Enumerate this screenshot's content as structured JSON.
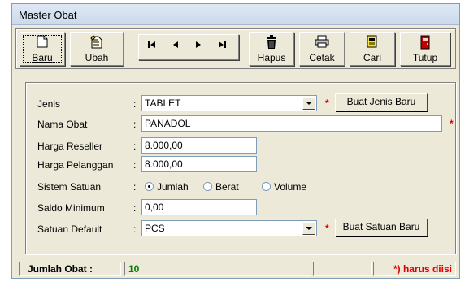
{
  "window": {
    "title": "Master Obat"
  },
  "toolbar": {
    "baru": "Baru",
    "ubah": "Ubah",
    "hapus": "Hapus",
    "cetak": "Cetak",
    "cari": "Cari",
    "tutup": "Tutup"
  },
  "form": {
    "jenis": {
      "label": "Jenis",
      "value": "TABLET",
      "button": "Buat Jenis Baru"
    },
    "nama_obat": {
      "label": "Nama Obat",
      "value": "PANADOL"
    },
    "harga_reseller": {
      "label": "Harga Reseller",
      "value": "8.000,00"
    },
    "harga_pelanggan": {
      "label": "Harga Pelanggan",
      "value": "8.000,00"
    },
    "sistem_satuan": {
      "label": "Sistem Satuan",
      "options": [
        "Jumlah",
        "Berat",
        "Volume"
      ],
      "selected": "Jumlah"
    },
    "saldo_minimum": {
      "label": "Saldo Minimum",
      "value": "0,00"
    },
    "satuan_default": {
      "label": "Satuan Default",
      "value": "PCS",
      "button": "Buat Satuan Baru"
    },
    "colon": ":",
    "required_mark": "*"
  },
  "status": {
    "label": "Jumlah Obat :",
    "count": "10",
    "note": "*) harus diisi"
  },
  "colors": {
    "required": "#e00000",
    "count": "#008000",
    "face": "#ece9d8"
  }
}
